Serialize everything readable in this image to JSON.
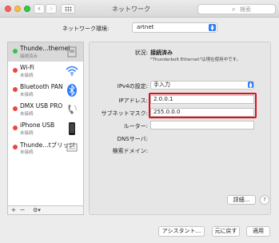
{
  "window": {
    "title": "ネットワーク",
    "search_placeholder": "検索"
  },
  "location": {
    "label": "ネットワーク環境:",
    "value": "artnet"
  },
  "sidebar": {
    "items": [
      {
        "name": "Thunde…thernet",
        "status": "接続済み",
        "state": "green",
        "icon": "ethernet-icon"
      },
      {
        "name": "Wi-Fi",
        "status": "未接続",
        "state": "red",
        "icon": "wifi-icon"
      },
      {
        "name": "Bluetooth PAN",
        "status": "未接続",
        "state": "red",
        "icon": "bluetooth-icon"
      },
      {
        "name": "DMX USB PRO",
        "status": "未接続",
        "state": "red",
        "icon": "phone-icon"
      },
      {
        "name": "iPhone USB",
        "status": "未接続",
        "state": "red",
        "icon": "iphone-icon"
      },
      {
        "name": "Thunde…tブリッジ",
        "status": "未接続",
        "state": "red",
        "icon": "bridge-icon"
      }
    ],
    "footer": {
      "plus": "+",
      "minus": "−",
      "gear": "⚙▾"
    }
  },
  "detail": {
    "status_label": "状況:",
    "status_value": "接続済み",
    "status_desc": "\"Thunderbolt Ethernet\"は現在使用中です。",
    "ipv4_label": "IPv4の設定:",
    "ipv4_value": "手入力",
    "ip_label": "IPアドレス:",
    "ip_value": "2.0.0.1",
    "subnet_label": "サブネットマスク:",
    "subnet_value": "255.0.0.0",
    "router_label": "ルーター:",
    "router_value": "",
    "dns_label": "DNSサーバ:",
    "search_domain_label": "検索ドメイン:",
    "details_button": "詳細...",
    "help_button": "?"
  },
  "buttons": {
    "assistant": "アシスタント...",
    "revert": "元に戻す",
    "apply": "適用"
  },
  "colors": {
    "connected": "#33c748",
    "disconnected": "#f0453a",
    "accent": "#2f7cf6",
    "highlight": "#e0101a"
  }
}
